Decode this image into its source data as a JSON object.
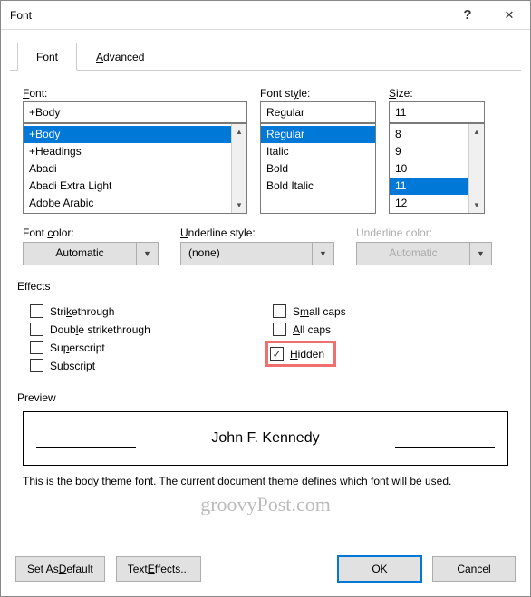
{
  "titlebar": {
    "title": "Font"
  },
  "tabs": {
    "font": "Font",
    "advanced": "Advanced"
  },
  "labels": {
    "font": "Font:",
    "fontstyle": "Font style:",
    "size": "Size:",
    "fontcolor": "Font color:",
    "underlinestyle": "Underline style:",
    "underlinecolor": "Underline color:",
    "effects": "Effects",
    "preview": "Preview"
  },
  "font": {
    "value": "+Body",
    "list": [
      "+Body",
      "+Headings",
      "Abadi",
      "Abadi Extra Light",
      "Adobe Arabic"
    ]
  },
  "style": {
    "value": "Regular",
    "list": [
      "Regular",
      "Italic",
      "Bold",
      "Bold Italic"
    ]
  },
  "size": {
    "value": "11",
    "list": [
      "8",
      "9",
      "10",
      "11",
      "12"
    ]
  },
  "combos": {
    "fontcolor": "Automatic",
    "underlinestyle": "(none)",
    "underlinecolor": "Automatic"
  },
  "effects": {
    "strikethrough": "Strikethrough",
    "dblstrike": "Double strikethrough",
    "superscript": "Superscript",
    "subscript": "Subscript",
    "smallcaps": "Small caps",
    "allcaps": "All caps",
    "hidden": "Hidden"
  },
  "preview_text": "John F. Kennedy",
  "description": "This is the body theme font. The current document theme defines which font will be used.",
  "watermark": "groovyPost.com",
  "buttons": {
    "default": "Set As Default",
    "texteffects": "Text Effects...",
    "ok": "OK",
    "cancel": "Cancel"
  }
}
